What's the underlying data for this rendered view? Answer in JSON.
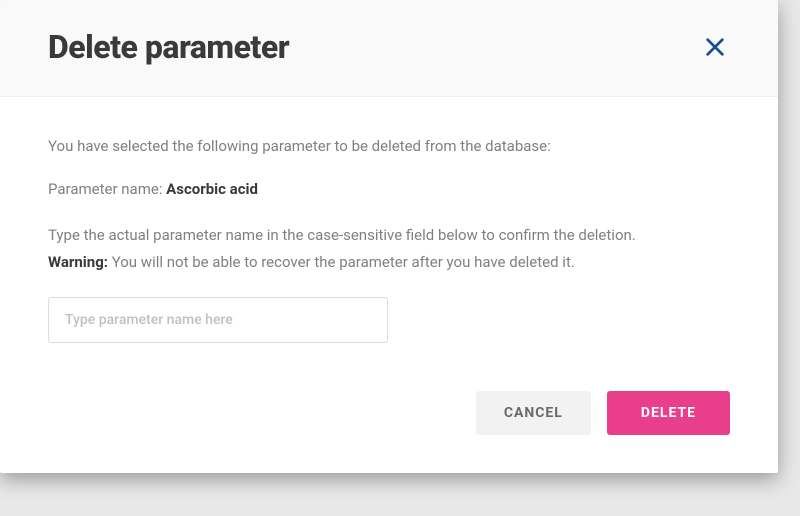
{
  "modal": {
    "title": "Delete parameter",
    "intro": "You have selected the following parameter to be deleted from the database:",
    "param_label": "Parameter name: ",
    "param_value": "Ascorbic acid",
    "instruction": "Type the actual parameter name in the case-sensitive field below to confirm the deletion.",
    "warning_label": "Warning: ",
    "warning_text": "You will not be able to recover the parameter after you have deleted it.",
    "input_placeholder": "Type parameter name here",
    "cancel_label": "CANCEL",
    "delete_label": "DELETE"
  }
}
